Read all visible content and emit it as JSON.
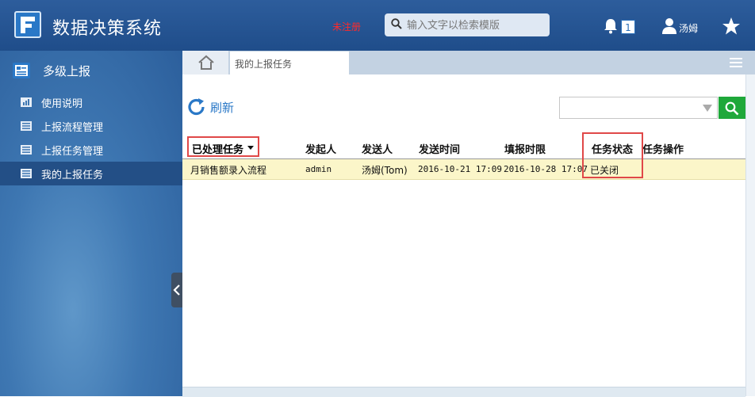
{
  "app": {
    "title": "数据决策系统",
    "unregistered": "未注册"
  },
  "search": {
    "placeholder": "输入文字以检索模版"
  },
  "header": {
    "notification_count": "1",
    "username": "汤姆"
  },
  "sidebar": {
    "heading": "多级上报",
    "items": [
      {
        "label": "使用说明",
        "icon": "chart-doc-icon"
      },
      {
        "label": "上报流程管理",
        "icon": "list-doc-icon"
      },
      {
        "label": "上报任务管理",
        "icon": "list-doc-icon"
      },
      {
        "label": "我的上报任务",
        "icon": "list-doc-icon",
        "active": true
      }
    ]
  },
  "tabs": [
    {
      "label": "我的上报任务",
      "active": true
    }
  ],
  "toolbar": {
    "refresh_label": "刷新"
  },
  "filter": {
    "value": ""
  },
  "table": {
    "columns": [
      "已处理任务",
      "发起人",
      "发送人",
      "发送时间",
      "填报时限",
      "任务状态",
      "任务操作"
    ],
    "rows": [
      {
        "name": "月销售额录入流程",
        "initiator": "admin",
        "sender": "汤姆(Tom)",
        "sent_time": "2016-10-21 17:09",
        "deadline": "2016-10-28 17:07",
        "status": "已关闭",
        "operation": ""
      }
    ]
  },
  "colors": {
    "header_bg": "#1f4d8a",
    "sidebar_bg": "#3e77b2",
    "accent": "#2a78c7",
    "highlight_row": "#fbf6c9",
    "annotation": "#e04848",
    "search_btn": "#1fa83a"
  }
}
